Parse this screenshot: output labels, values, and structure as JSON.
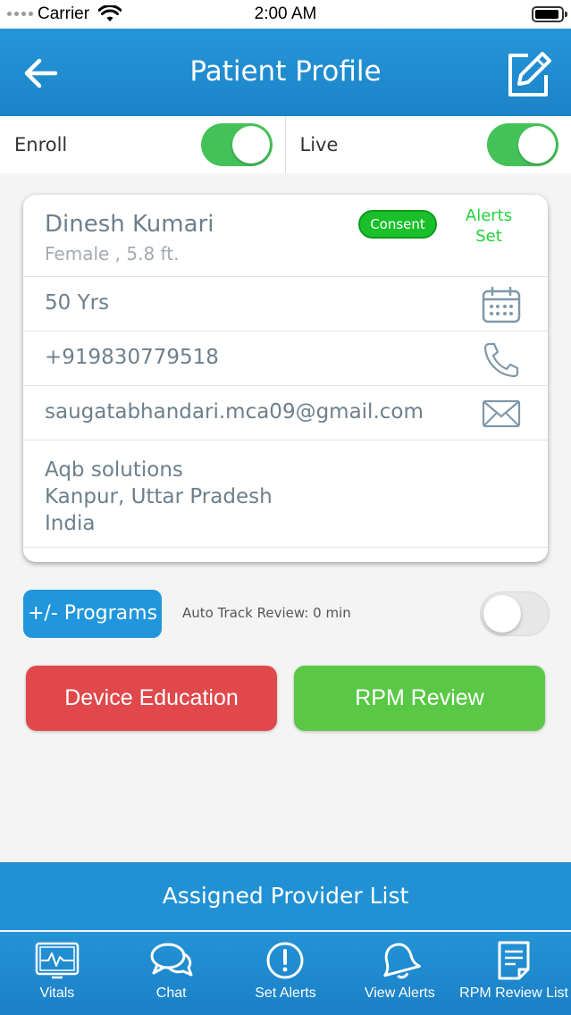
{
  "status_bar": {
    "carrier": "Carrier",
    "time": "2:00 AM"
  },
  "header": {
    "title": "Patient Profile",
    "back_icon": "back-arrow-icon",
    "edit_icon": "edit-icon"
  },
  "toggles": {
    "enroll_label": "Enroll",
    "enroll_on": true,
    "live_label": "Live",
    "live_on": true
  },
  "patient": {
    "name": "Dinesh Kumari",
    "gender_height": "Female , 5.8 ft.",
    "consent_label": "Consent",
    "alerts_set_line1": "Alerts",
    "alerts_set_line2": "Set",
    "age": "50 Yrs",
    "phone": "+919830779518",
    "email": "saugatabhandari.mca09@gmail.com",
    "address_line1": "Aqb solutions",
    "address_line2": "Kanpur, Uttar Pradesh",
    "address_line3": "India"
  },
  "programs": {
    "button_label": "+/- Programs",
    "auto_track": "Auto Track Review: 0 min",
    "auto_track_on": false
  },
  "actions": {
    "device_education": "Device Education",
    "rpm_review": "RPM Review"
  },
  "provider_bar": {
    "label": "Assigned Provider List"
  },
  "tab_bar": {
    "tabs": [
      {
        "label": "Vitals",
        "icon": "vitals-icon"
      },
      {
        "label": "Chat",
        "icon": "chat-icon"
      },
      {
        "label": "Set Alerts",
        "icon": "alert-circle-icon"
      },
      {
        "label": "View Alerts",
        "icon": "bell-icon"
      },
      {
        "label": "RPM Review List",
        "icon": "document-icon"
      }
    ]
  },
  "colors": {
    "header_blue": "#2191d4",
    "toggle_green": "#44c25a",
    "consent_green": "#19c02a",
    "device_red": "#e0484b",
    "rpm_green": "#5ac846",
    "text_gray": "#6d7f8c",
    "icon_gray": "#7f98aa"
  }
}
